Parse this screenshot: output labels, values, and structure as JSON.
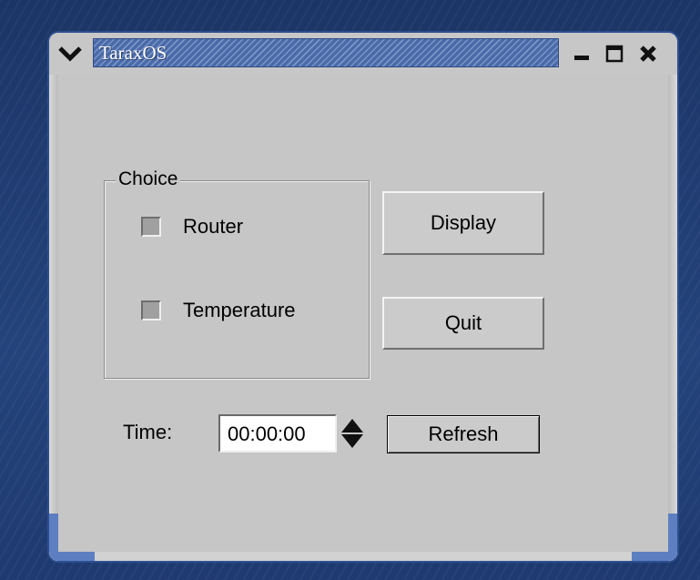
{
  "window": {
    "title": "TaraxOS",
    "controls": {
      "menu_icon": "chevron-down-icon",
      "minimize_icon": "minimize-icon",
      "maximize_icon": "maximize-icon",
      "close_icon": "close-icon"
    }
  },
  "choice": {
    "title": "Choice",
    "options": [
      {
        "label": "Router",
        "checked": false
      },
      {
        "label": "Temperature",
        "checked": false
      }
    ]
  },
  "buttons": {
    "display": "Display",
    "quit": "Quit",
    "refresh": "Refresh"
  },
  "time": {
    "label": "Time:",
    "value": "00:00:00"
  },
  "colors": {
    "desktop": "#1f3a6e",
    "window_bg": "#c6c6c6",
    "title_accent": "#4a6aa8"
  }
}
